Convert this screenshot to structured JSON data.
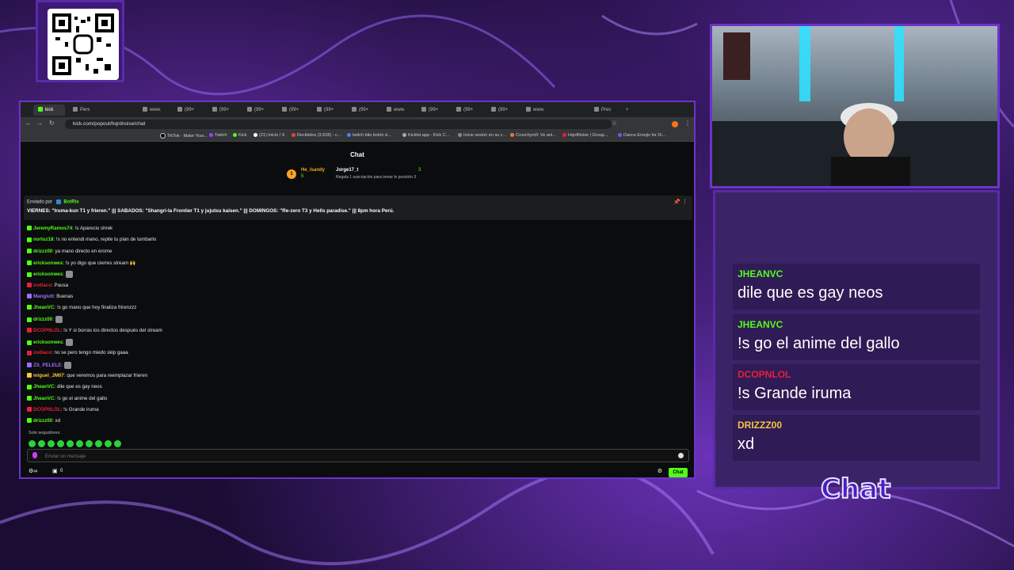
{
  "browser": {
    "tabs": [
      "Pers",
      "www.",
      "(99+",
      "(99+",
      "(99+",
      "(99+",
      "(99+",
      "(99+",
      "www.",
      "(99+",
      "(99+",
      "(99+",
      "www.",
      "Pres"
    ],
    "active_tab": "kick",
    "url": "kick.com/popout/hqrdnoise/chat",
    "bookmarks": [
      "TikTok - Make Your...",
      "Twitch",
      "Kick",
      "(21) Inicio / X",
      "Recibidos (3,628) - c...",
      "twitch bits botón d...",
      "Kicklet.app - Kick C...",
      "Inicie sesión en su c...",
      "Crunchyroll: Ve ani...",
      "HqrdNoise | Group...",
      "Dance Emojis for Di..."
    ]
  },
  "chat": {
    "title": "Chat",
    "gifter_1": {
      "rank": "1",
      "name": "He_Isandy",
      "count": "5"
    },
    "gifter_2": {
      "name": "Jorge17_t",
      "count": "3",
      "hint": "Regala 1 suscripción para tomar le posición 3"
    },
    "pinned": {
      "by_label": "Enviado por",
      "by_user": "BotRix",
      "text": "VIERNES: \"Iruma-kun T1 y frieren.\" ||| SABADOS: \"Shangri-la Frontier T1 y jujutsu kaisen.\" ||| DOMINGOS: \"Re-zero T3 y Hells paradise.\" ||| 8pm hora Perú."
    },
    "messages": [
      {
        "user": "JeremyRamos74",
        "color": "#53fc18",
        "text": "!s Aparecio shrek"
      },
      {
        "user": "norluz18",
        "color": "#53fc18",
        "text": "!s no entendi mano, repite tu plan de tumbarlo"
      },
      {
        "user": "drizzz00",
        "color": "#53fc18",
        "text": "ya mano directo en erome"
      },
      {
        "user": "ericksonwes",
        "color": "#53fc18",
        "text": "!s yo digo que cierres stream 🙌"
      },
      {
        "user": "ericksonwes",
        "color": "#53fc18",
        "text": ""
      },
      {
        "user": "zodiaco",
        "color": "#e91e3c",
        "text": "Pausa"
      },
      {
        "user": "Mangiutt",
        "color": "#9b6cff",
        "text": "Buenas"
      },
      {
        "user": "JheanVC",
        "color": "#53fc18",
        "text": "!s go mano que hoy finaliza frirenzzz"
      },
      {
        "user": "drizzz00",
        "color": "#53fc18",
        "text": ""
      },
      {
        "user": "DCOPNLOL",
        "color": "#e91e3c",
        "text": "!s Y si borras los directos después del stream"
      },
      {
        "user": "ericksonwes",
        "color": "#53fc18",
        "text": ""
      },
      {
        "user": "zodiaco",
        "color": "#e91e3c",
        "text": "no se pero tengo miedo skip gaaa"
      },
      {
        "user": "ZS_PELELE",
        "color": "#9b6cff",
        "text": ""
      },
      {
        "user": "miguel_JM07",
        "color": "#f5c542",
        "text": "que veremos para reemplazar frieren"
      },
      {
        "user": "JheanVC",
        "color": "#53fc18",
        "text": "dile que es gay neos"
      },
      {
        "user": "JheanVC",
        "color": "#53fc18",
        "text": "!s go el anime del gallo"
      },
      {
        "user": "DCOPNLOL",
        "color": "#e91e3c",
        "text": "!s Grande iruma"
      },
      {
        "user": "drizzz00",
        "color": "#53fc18",
        "text": "xd"
      }
    ],
    "followers_only": "Solo seguidores",
    "input_placeholder": "Enviar un mensaje",
    "viewer_count": "0",
    "send_label": "Chat"
  },
  "overlay": {
    "messages": [
      {
        "user": "JHEANVC",
        "color": "#53fc18",
        "text": "dile que es gay neos"
      },
      {
        "user": "JHEANVC",
        "color": "#53fc18",
        "text": "!s go el anime del gallo"
      },
      {
        "user": "DCOPNLOL",
        "color": "#e91e3c",
        "text": "!s Grande iruma"
      },
      {
        "user": "DRIZZZ00",
        "color": "#f5c542",
        "text": "xd"
      }
    ],
    "label": "Chat"
  }
}
